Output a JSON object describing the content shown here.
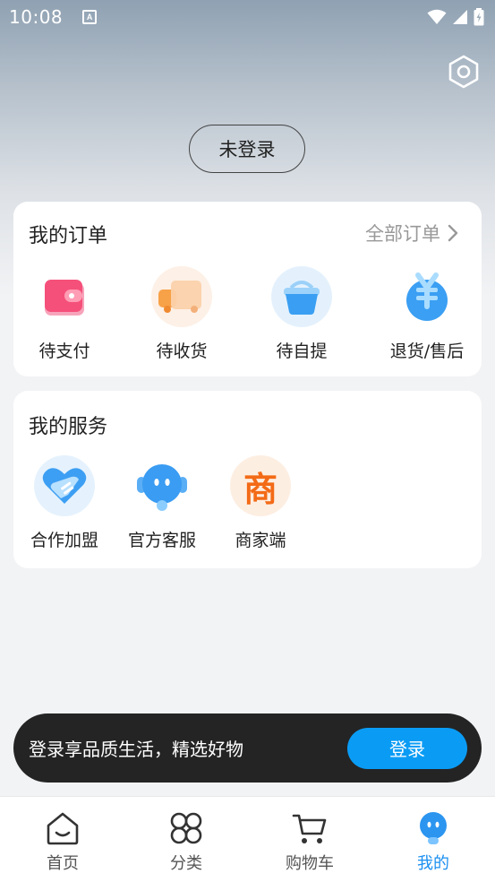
{
  "status_bar": {
    "time": "10:08",
    "notif_letter": "A"
  },
  "profile": {
    "login_status": "未登录"
  },
  "orders": {
    "title": "我的订单",
    "all_label": "全部订单",
    "items": [
      {
        "label": "待支付",
        "icon": "wallet-icon"
      },
      {
        "label": "待收货",
        "icon": "truck-icon"
      },
      {
        "label": "待自提",
        "icon": "basket-icon"
      },
      {
        "label": "退货/售后",
        "icon": "yen-refund-icon"
      }
    ]
  },
  "services": {
    "title": "我的服务",
    "items": [
      {
        "label": "合作加盟",
        "icon": "handshake-heart-icon"
      },
      {
        "label": "官方客服",
        "icon": "robot-service-icon"
      },
      {
        "label": "商家端",
        "icon": "merchant-icon",
        "glyph": "商"
      }
    ]
  },
  "toast": {
    "text": "登录享品质生活，精选好物",
    "button": "登录"
  },
  "tabbar": {
    "items": [
      {
        "label": "首页",
        "icon": "home-icon"
      },
      {
        "label": "分类",
        "icon": "category-icon"
      },
      {
        "label": "购物车",
        "icon": "cart-icon"
      },
      {
        "label": "我的",
        "icon": "profile-icon"
      }
    ],
    "active_index": 3
  },
  "colors": {
    "accent": "#0a9cf5",
    "tab_active": "#1a8ff0",
    "merchant_orange": "#f36a16",
    "wallet_pink": "#f5507a"
  }
}
